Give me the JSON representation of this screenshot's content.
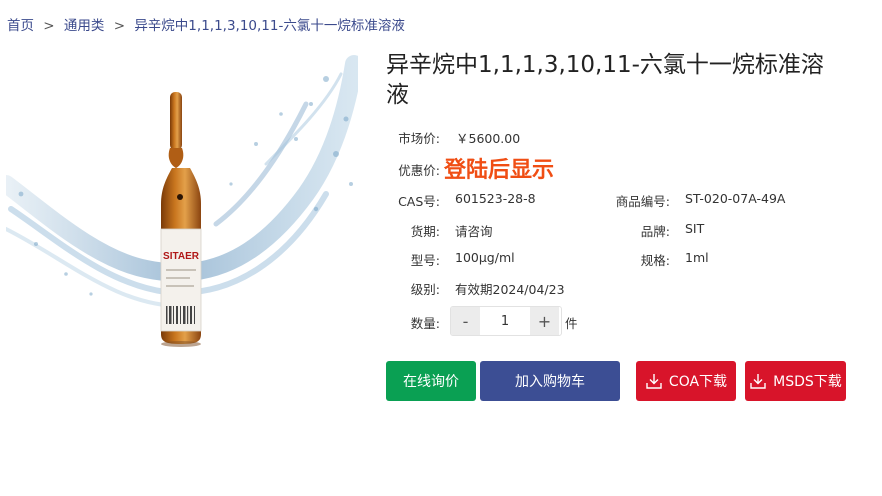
{
  "breadcrumb": {
    "home": "首页",
    "category": "通用类",
    "current": "异辛烷中1,1,1,3,10,11-六氯十一烷标准溶液",
    "separator": ">"
  },
  "product": {
    "title": "异辛烷中1,1,1,3,10,11-六氯十一烷标准溶液",
    "market_price_label": "市场价:",
    "market_price": "￥5600.00",
    "special_price_label": "优惠价:",
    "special_price": "登陆后显示",
    "cas_label": "CAS号:",
    "cas": "601523-28-8",
    "item_no_label": "商品编号:",
    "item_no": "ST-020-07A-49A",
    "delivery_label": "货期:",
    "delivery": "请咨询",
    "brand_label": "品牌:",
    "brand": "SIT",
    "model_label": "型号:",
    "model": "100μg/ml",
    "spec_label": "规格:",
    "spec": "1ml",
    "grade_label": "级别:",
    "grade": "有效期2024/04/23",
    "qty_label": "数量:",
    "qty": "1",
    "qty_unit": "件",
    "minus": "-",
    "plus": "+"
  },
  "buttons": {
    "inquiry": "在线询价",
    "cart": "加入购物车",
    "coa": "COA下载",
    "msds": "MSDS下载"
  },
  "colors": {
    "inquiry": "#0aa053",
    "cart": "#3c4e94",
    "download": "#d8142a",
    "special_price": "#f04e14"
  },
  "image": {
    "label_text": "SITAER"
  }
}
